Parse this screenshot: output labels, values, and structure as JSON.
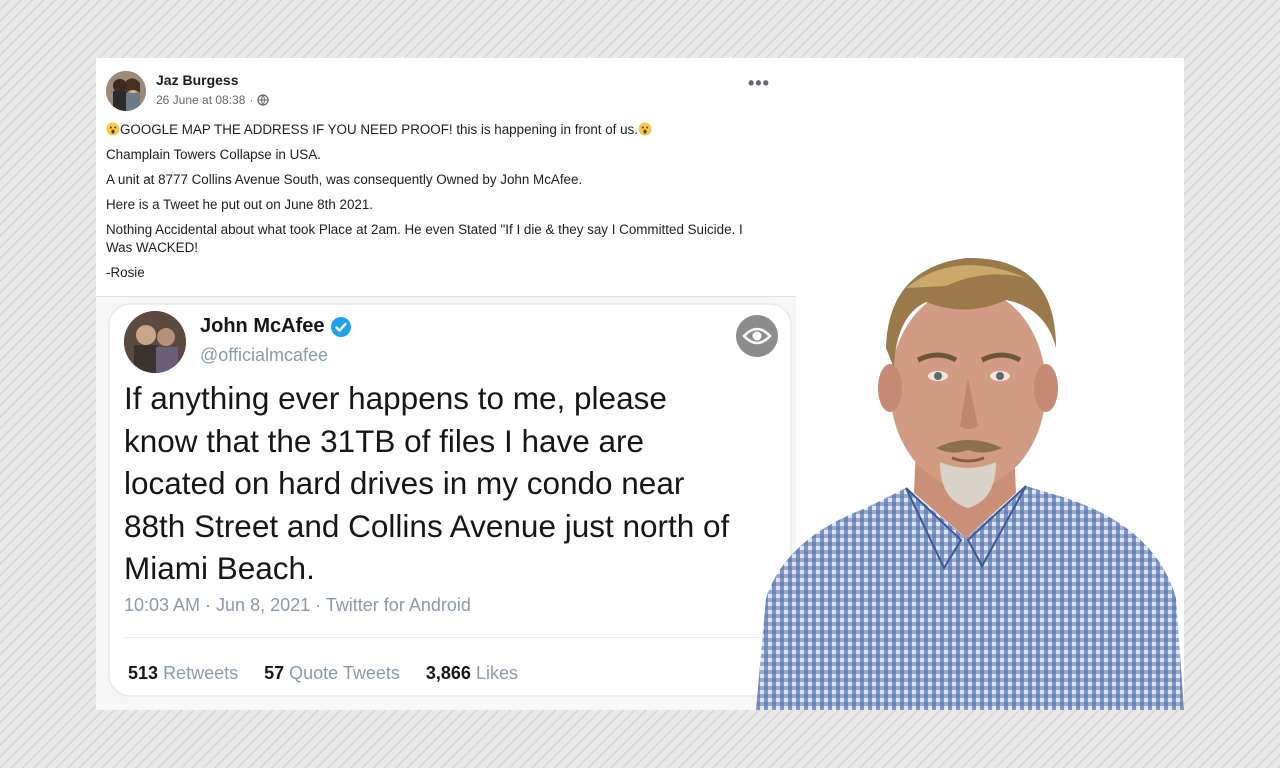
{
  "post": {
    "author": "Jaz Burgess",
    "date": "26 June at 08:38",
    "separator": "·",
    "more_label": "•••",
    "lines": [
      "GOOGLE MAP THE ADDRESS  IF YOU NEED PROOF! this is happening in front of us.",
      "Champlain Towers Collapse in USA.",
      "A unit at 8777 Collins Avenue South, was consequently Owned by John McAfee.",
      "Here is a Tweet he put out on June 8th 2021.",
      "Nothing Accidental about what took Place at 2am.  He even Stated \"If I die & they say I Committed Suicide. I Was WACKED!",
      "-Rosie"
    ],
    "icons": {
      "privacy": "globe-icon",
      "reaction": "shocked-face-emoji",
      "more": "more-options-icon"
    }
  },
  "tweet": {
    "name": "John McAfee",
    "handle": "@officialmcafee",
    "text_lines": [
      "If anything ever happens to me, please",
      "know that the 31TB of files I have are",
      "located on hard drives in my condo near",
      "88th Street and Collins Avenue just north of",
      "Miami Beach."
    ],
    "timestamp": "10:03 AM · Jun 8, 2021 · Twitter for Android",
    "stats": {
      "retweets_count": "513",
      "retweets_label": "Retweets",
      "quotes_count": "57",
      "quotes_label": "Quote Tweets",
      "likes_count": "3,866",
      "likes_label": "Likes"
    },
    "icons": {
      "verified": "verified-badge-icon",
      "sensitive": "eye-icon"
    }
  },
  "colors": {
    "background_stripe": "#d9d9d9",
    "card": "#ffffff",
    "text_primary": "#1c1e21",
    "text_secondary": "#65676b",
    "twitter_verified": "#1da1f2",
    "tweet_meta": "#8a9aa8",
    "shirt_blue": "#3a5a9c"
  }
}
